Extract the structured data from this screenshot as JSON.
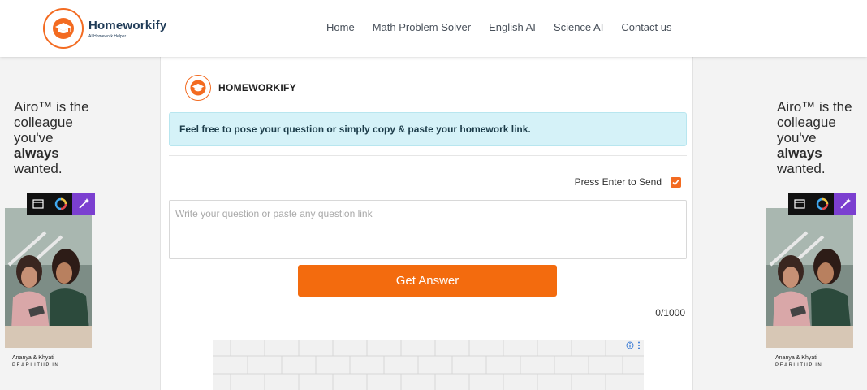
{
  "header": {
    "logo_title": "Homeworkify",
    "logo_subtitle": "AI Homework Helper",
    "nav": [
      {
        "label": "Home"
      },
      {
        "label": "Math Problem Solver"
      },
      {
        "label": "English AI"
      },
      {
        "label": "Science AI"
      },
      {
        "label": "Contact us"
      }
    ]
  },
  "side_ad": {
    "line1": "Airo™ is the",
    "line2": "colleague",
    "line3": "you've",
    "line4_bold": "always",
    "line5": "wanted.",
    "caption": "Ananya & Khyati",
    "brand": "PEARLITUP.IN",
    "icons": [
      "window-icon",
      "color-ring-icon",
      "magic-wand-icon"
    ]
  },
  "main": {
    "brand_name": "HOMEWORKIFY",
    "info_text": "Feel free to pose your question or simply copy & paste your homework link.",
    "enter_label": "Press Enter to Send",
    "enter_checked": true,
    "question_placeholder": "Write your question or paste any question link",
    "question_value": "",
    "submit_label": "Get Answer",
    "counter": "0/1000"
  },
  "colors": {
    "accent": "#f36b0e",
    "info_bg": "#d5f2f8",
    "brand_dark": "#1f3b57"
  }
}
